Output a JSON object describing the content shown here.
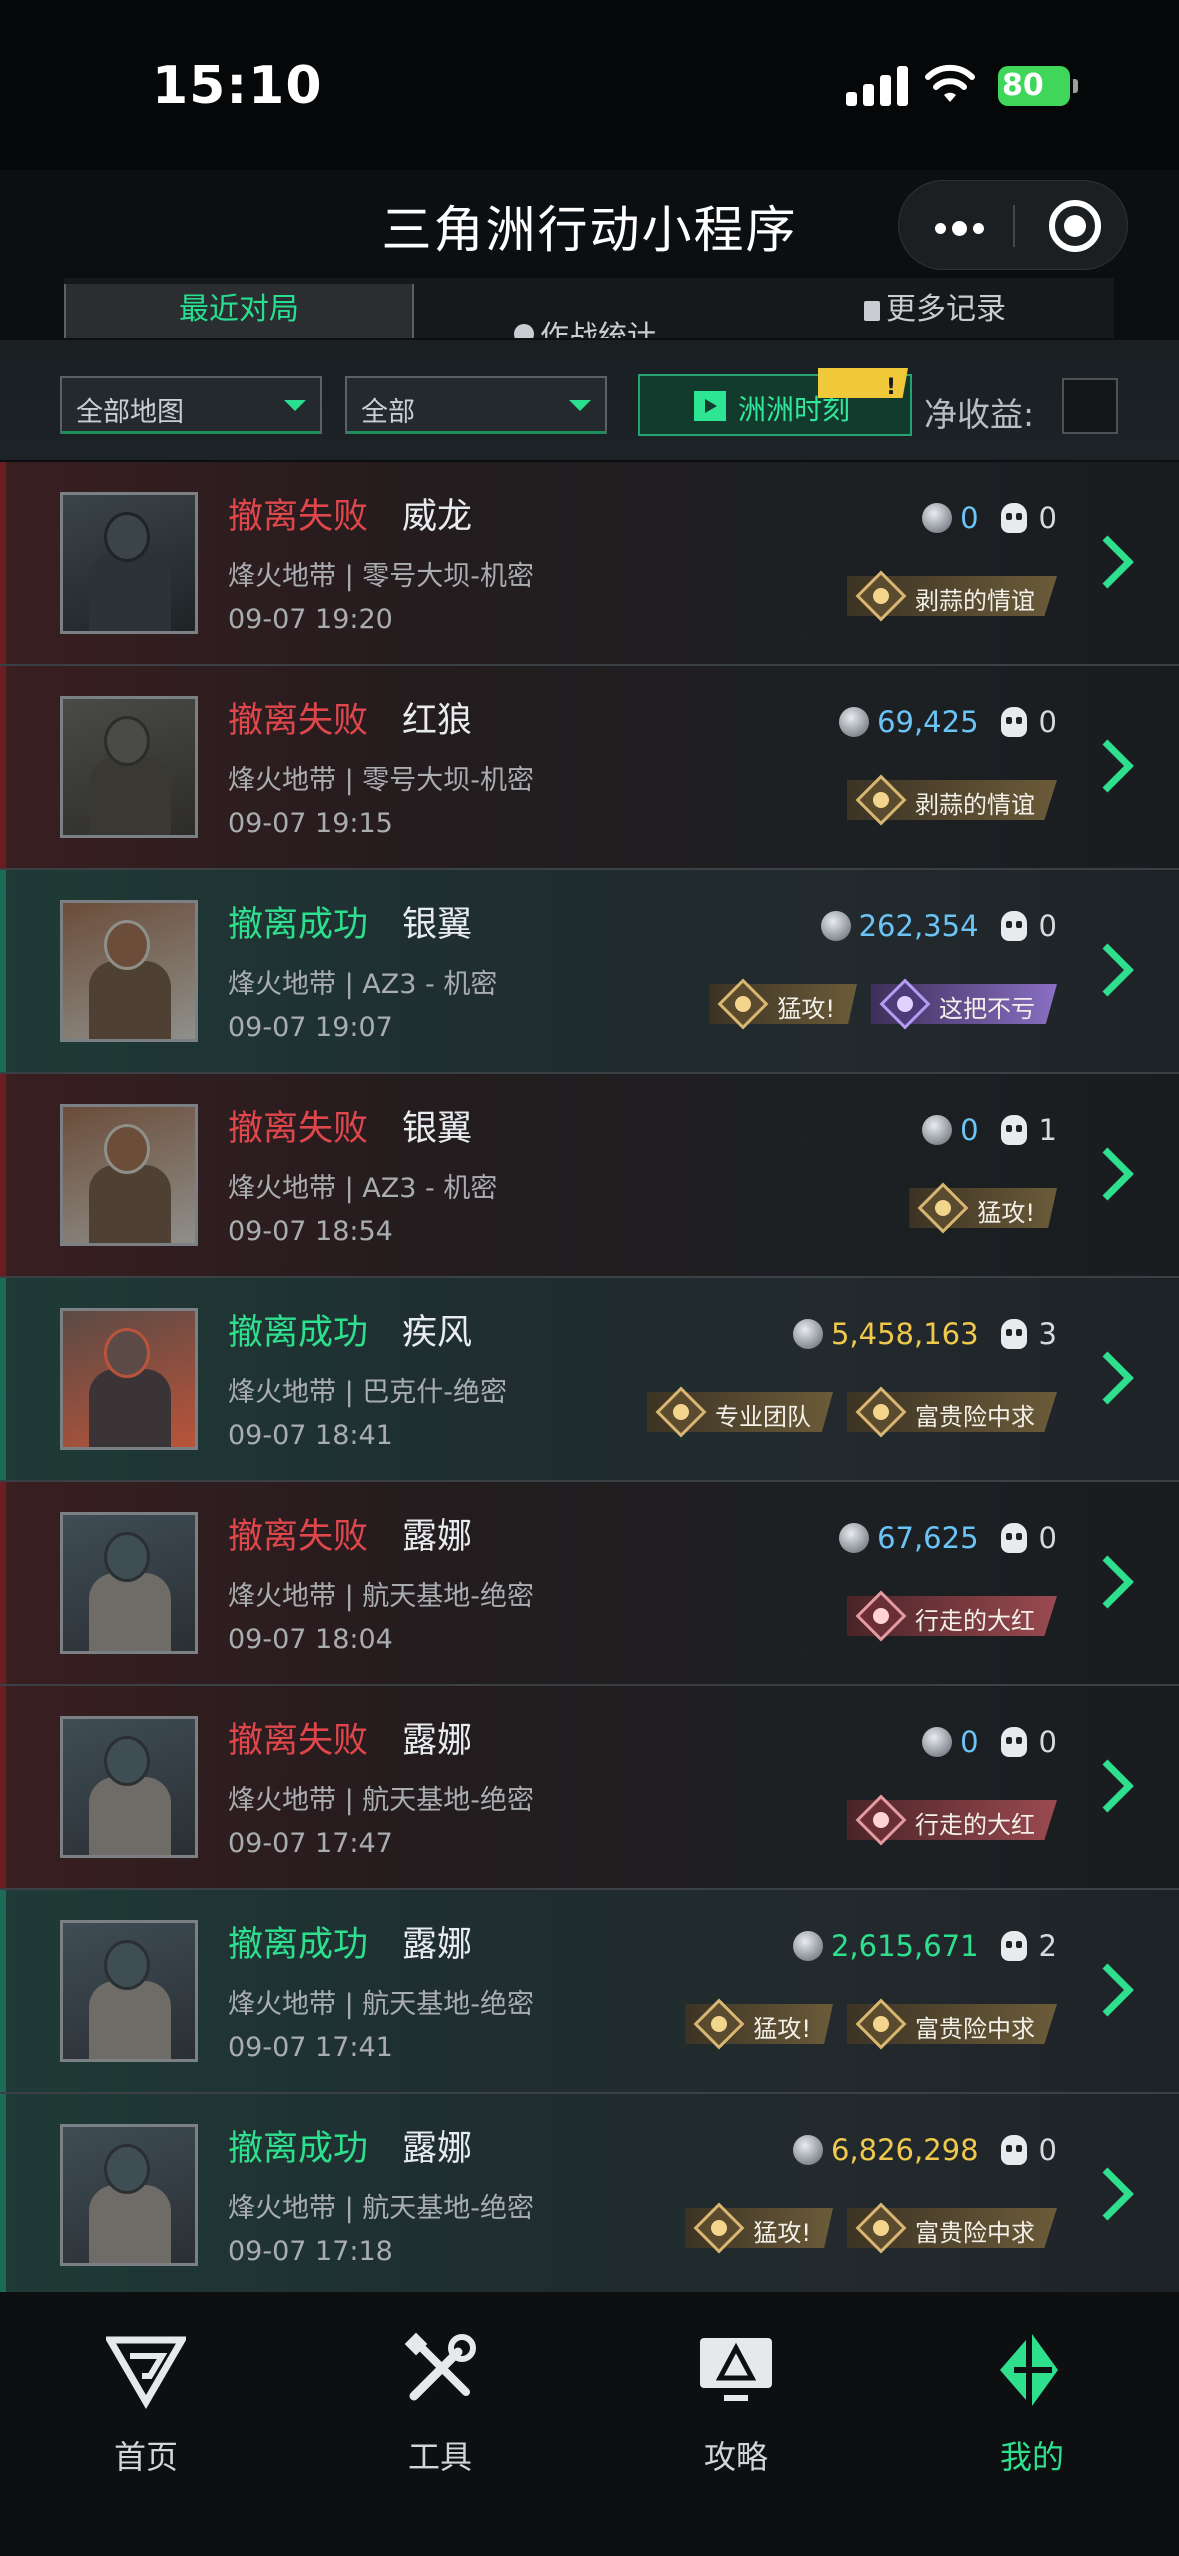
{
  "status": {
    "time": "15:10",
    "battery": "80"
  },
  "header": {
    "title": "三角洲行动小程序"
  },
  "tabs": [
    {
      "label": "最近对局"
    },
    {
      "label": "作战统计"
    },
    {
      "label": "更多记录"
    }
  ],
  "filters": {
    "map": "全部地图",
    "mode": "全部",
    "moment_button": "洲洲时刻",
    "moment_badge": "!",
    "net_label": "净收益:"
  },
  "matches": [
    {
      "result": "撤离失败",
      "status": "fail",
      "operator": "威龙",
      "map": "烽火地带 | 零号大坝-机密",
      "date": "09-07 19:20",
      "value": "0",
      "value_color": "blue",
      "kills": "0",
      "badges": [
        {
          "label": "剥蒜的情谊",
          "style": "gold"
        }
      ]
    },
    {
      "result": "撤离失败",
      "status": "fail",
      "operator": "红狼",
      "map": "烽火地带 | 零号大坝-机密",
      "date": "09-07 19:15",
      "value": "69,425",
      "value_color": "blue",
      "kills": "0",
      "badges": [
        {
          "label": "剥蒜的情谊",
          "style": "gold"
        }
      ]
    },
    {
      "result": "撤离成功",
      "status": "success",
      "operator": "银翼",
      "map": "烽火地带 | AZ3 - 机密",
      "date": "09-07 19:07",
      "value": "262,354",
      "value_color": "blue",
      "kills": "0",
      "badges": [
        {
          "label": "猛攻!",
          "style": "gold"
        },
        {
          "label": "这把不亏",
          "style": "purple"
        }
      ]
    },
    {
      "result": "撤离失败",
      "status": "fail",
      "operator": "银翼",
      "map": "烽火地带 | AZ3 - 机密",
      "date": "09-07 18:54",
      "value": "0",
      "value_color": "blue",
      "kills": "1",
      "badges": [
        {
          "label": "猛攻!",
          "style": "gold"
        }
      ]
    },
    {
      "result": "撤离成功",
      "status": "success",
      "operator": "疾风",
      "map": "烽火地带 | 巴克什-绝密",
      "date": "09-07 18:41",
      "value": "5,458,163",
      "value_color": "gold",
      "kills": "3",
      "badges": [
        {
          "label": "专业团队",
          "style": "gold"
        },
        {
          "label": "富贵险中求",
          "style": "gold"
        }
      ]
    },
    {
      "result": "撤离失败",
      "status": "fail",
      "operator": "露娜",
      "map": "烽火地带 | 航天基地-绝密",
      "date": "09-07 18:04",
      "value": "67,625",
      "value_color": "blue",
      "kills": "0",
      "badges": [
        {
          "label": "行走的大红",
          "style": "red"
        }
      ]
    },
    {
      "result": "撤离失败",
      "status": "fail",
      "operator": "露娜",
      "map": "烽火地带 | 航天基地-绝密",
      "date": "09-07 17:47",
      "value": "0",
      "value_color": "blue",
      "kills": "0",
      "badges": [
        {
          "label": "行走的大红",
          "style": "red"
        }
      ]
    },
    {
      "result": "撤离成功",
      "status": "success",
      "operator": "露娜",
      "map": "烽火地带 | 航天基地-绝密",
      "date": "09-07 17:41",
      "value": "2,615,671",
      "value_color": "green",
      "kills": "2",
      "badges": [
        {
          "label": "猛攻!",
          "style": "gold"
        },
        {
          "label": "富贵险中求",
          "style": "gold"
        }
      ]
    },
    {
      "result": "撤离成功",
      "status": "success",
      "operator": "露娜",
      "map": "烽火地带 | 航天基地-绝密",
      "date": "09-07 17:18",
      "value": "6,826,298",
      "value_color": "gold",
      "kills": "0",
      "badges": [
        {
          "label": "猛攻!",
          "style": "gold"
        },
        {
          "label": "富贵险中求",
          "style": "gold"
        }
      ]
    }
  ],
  "nav": [
    {
      "label": "首页"
    },
    {
      "label": "工具"
    },
    {
      "label": "攻略"
    },
    {
      "label": "我的",
      "active": true
    }
  ],
  "colors": {
    "accent": "#2ee08e",
    "fail": "#e0474c",
    "value_blue": "#6bc4f6",
    "value_gold": "#efc84c"
  }
}
